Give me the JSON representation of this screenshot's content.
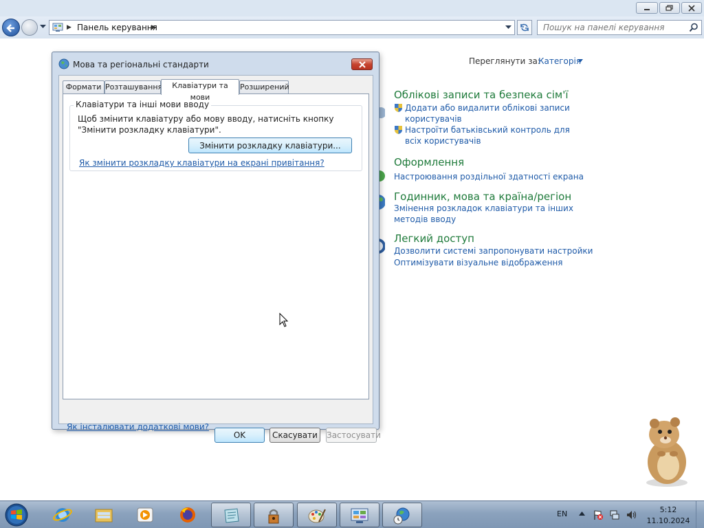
{
  "explorer": {
    "breadcrumb": "Панель керування",
    "search_placeholder": "Пошук на панелі керування"
  },
  "control_panel": {
    "view_by_label": "Переглянути за:",
    "view_by_value": "Категорія",
    "categories": [
      {
        "title": "Облікові записи та безпека сім'ї",
        "links": [
          "Додати або видалити облікові записи користувачів",
          "Настроїти батьківський контроль для всіх користувачів"
        ]
      },
      {
        "title": "Оформлення",
        "links": [
          "Настроювання роздільної здатності екрана"
        ]
      },
      {
        "title": "Годинник, мова та країна/регіон",
        "links": [
          "Змінення розкладок клавіатури та інших методів вводу"
        ]
      },
      {
        "title": "Легкий доступ",
        "links": [
          "Дозволити системі запропонувати настройки",
          "Оптимізувати візуальне відображення"
        ]
      }
    ]
  },
  "dialog": {
    "title": "Мова та регіональні стандарти",
    "tabs": [
      "Формати",
      "Розташування",
      "Клавіатури та мови",
      "Розширений"
    ],
    "active_tab": "Клавіатури та мови",
    "group_label": "Клавіатури та інші мови вводу",
    "group_description": "Щоб змінити клавіатуру або мову вводу, натисніть кнопку \"Змінити розкладку клавіатури\".",
    "change_keyboard_button": "Змінити розкладку клавіатури...",
    "welcome_screen_link": "Як змінити розкладку клавіатури на екрані привітання?",
    "install_languages_link": "Як інсталювати додаткові мови?",
    "ok_button": "OK",
    "cancel_button": "Скасувати",
    "apply_button": "Застосувати"
  },
  "taskbar": {
    "language": "EN",
    "time": "5:12",
    "date": "11.10.2024",
    "items": [
      "start-orb",
      "internet-explorer",
      "windows-explorer",
      "media-player",
      "firefox",
      "notepad-app",
      "lock-app",
      "paint-app",
      "control-panel-app",
      "region-globe-app"
    ]
  }
}
